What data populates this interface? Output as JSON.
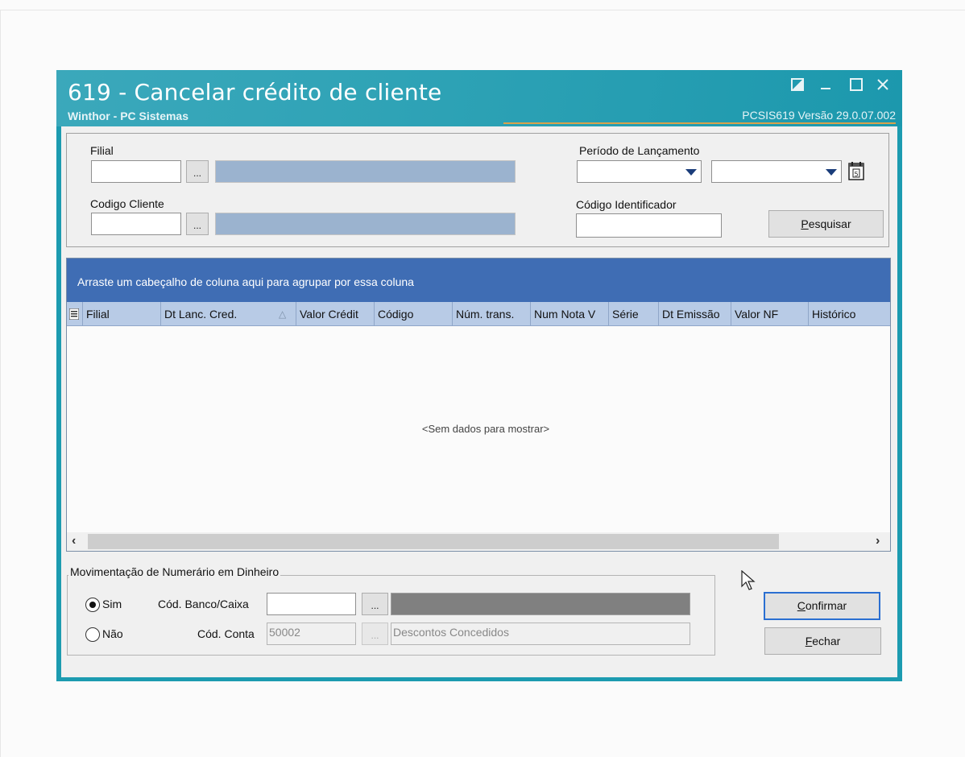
{
  "window": {
    "title": "619 - Cancelar crédito de cliente",
    "subtitle": "Winthor - PC Sistemas",
    "version": "PCSIS619  Versão  29.0.07.002"
  },
  "window_controls": [
    "restore-icon",
    "minimize-icon",
    "maximize-icon",
    "close-icon"
  ],
  "filters": {
    "filial_label": "Filial",
    "filial_value": "",
    "codigo_cliente_label": "Codigo Cliente",
    "codigo_cliente_value": "",
    "browse_label": "...",
    "periodo_label": "Período de Lançamento",
    "periodo_inicio": "",
    "periodo_fim": "",
    "codigo_identificador_label": "Código Identificador",
    "codigo_identificador_value": "",
    "pesquisar_label": "Pesquisar"
  },
  "grid": {
    "group_hint": "Arraste um cabeçalho de coluna aqui para agrupar por essa coluna",
    "columns": [
      "Filial",
      "Dt Lanc. Cred.",
      "Valor Crédit",
      "Código",
      "Núm. trans.",
      "Num Nota V",
      "Série",
      "Dt Emissão",
      "Valor NF",
      "Histórico"
    ],
    "sorted_column": "Dt Lanc. Cred.",
    "sort_direction": "ascending",
    "empty_text": "<Sem dados para mostrar>",
    "rows": []
  },
  "movimentacao": {
    "legend": "Movimentação de Numerário em Dinheiro",
    "options": [
      {
        "label": "Sim",
        "selected": true
      },
      {
        "label": "Não",
        "selected": false
      }
    ],
    "banco_caixa_label": "Cód. Banco/Caixa",
    "banco_caixa_value": "",
    "conta_label": "Cód. Conta",
    "conta_value": "50002",
    "conta_desc": "Descontos Concedidos"
  },
  "actions": {
    "confirmar_label": "Confirmar",
    "fechar_label": "Fechar"
  }
}
